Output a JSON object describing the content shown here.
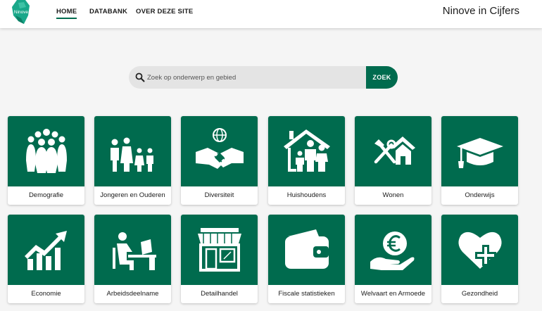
{
  "header": {
    "logo_text": "Ninove",
    "nav": [
      {
        "label": "HOME",
        "active": true
      },
      {
        "label": "DATABANK",
        "active": false
      },
      {
        "label": "OVER DEZE SITE",
        "active": false
      }
    ],
    "site_title": "Ninove in Cijfers"
  },
  "search": {
    "placeholder": "Zoek op onderwerp en gebied",
    "button_label": "ZOEK"
  },
  "colors": {
    "brand_green": "#006b4e",
    "logo_teal": "#1aa88a"
  },
  "tiles": [
    {
      "label": "Demografie",
      "icon": "people-group-icon"
    },
    {
      "label": "Jongeren en Ouderen",
      "icon": "family-icon"
    },
    {
      "label": "Diversiteit",
      "icon": "handshake-globe-icon"
    },
    {
      "label": "Huishoudens",
      "icon": "household-icon"
    },
    {
      "label": "Wonen",
      "icon": "house-tools-icon"
    },
    {
      "label": "Onderwijs",
      "icon": "graduation-cap-icon"
    },
    {
      "label": "Economie",
      "icon": "growth-chart-icon"
    },
    {
      "label": "Arbeidsdeelname",
      "icon": "desk-worker-icon"
    },
    {
      "label": "Detailhandel",
      "icon": "storefront-icon"
    },
    {
      "label": "Fiscale statistieken",
      "icon": "wallet-icon"
    },
    {
      "label": "Welvaart en Armoede",
      "icon": "euro-hand-icon"
    },
    {
      "label": "Gezondheid",
      "icon": "heart-cross-icon"
    }
  ]
}
